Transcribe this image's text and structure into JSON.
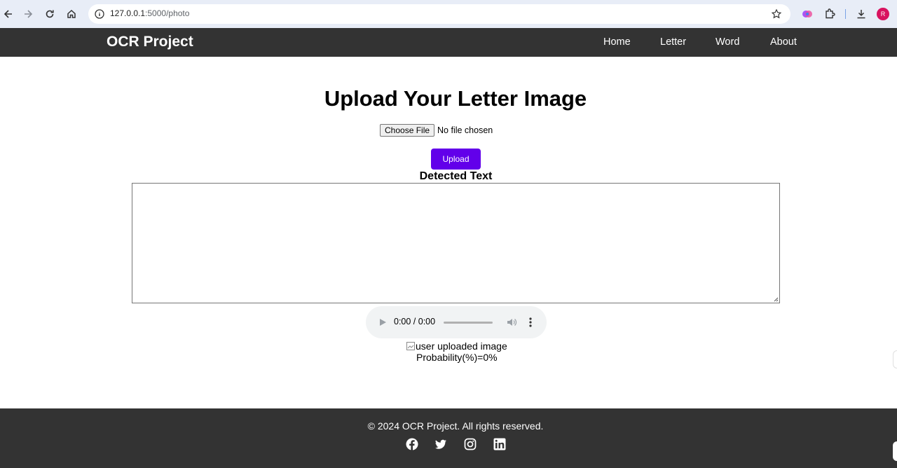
{
  "browser": {
    "url_host": "127.0.0.1",
    "url_path": ":5000/photo",
    "profile_initial": "R",
    "icons": [
      "back-icon",
      "forward-icon",
      "reload-icon",
      "home-icon",
      "info-icon",
      "star-icon",
      "extension-icon",
      "puzzle-icon",
      "download-icon"
    ]
  },
  "header": {
    "brand": "OCR Project",
    "nav": [
      {
        "label": "Home"
      },
      {
        "label": "Letter"
      },
      {
        "label": "Word"
      },
      {
        "label": "About"
      }
    ]
  },
  "main": {
    "title": "Upload Your Letter Image",
    "choose_file_label": "Choose File",
    "file_status": "No file chosen",
    "upload_label": "Upload",
    "detected_heading": "Detected Text",
    "detected_text": "",
    "audio": {
      "time": "0:00 / 0:00",
      "progress": 0
    },
    "image_alt": "user uploaded image",
    "probability": "Probability(%)=0%"
  },
  "footer": {
    "copyright": "© 2024 OCR Project. All rights reserved.",
    "social": [
      "facebook-icon",
      "twitter-icon",
      "instagram-icon",
      "linkedin-icon"
    ]
  },
  "colors": {
    "header_bg": "#333333",
    "upload_button": "#6200ea",
    "browser_bar": "#e8edf7",
    "profile": "#d8135f"
  }
}
